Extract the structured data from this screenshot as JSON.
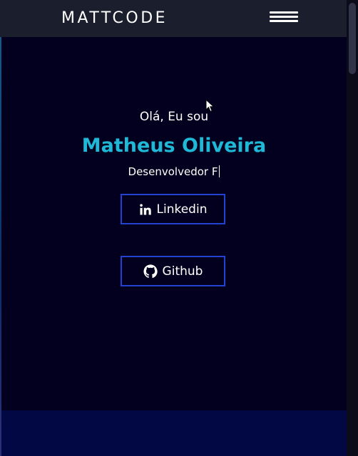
{
  "header": {
    "brand": "MATTCODE",
    "menu_icon": "hamburger-menu-icon"
  },
  "hero": {
    "greeting": "Olá, Eu sou",
    "name": "Matheus Oliveira",
    "role_typed": "Desenvolvedor F"
  },
  "buttons": [
    {
      "label": "Linkedin",
      "icon": "linkedin-icon"
    },
    {
      "label": "Github",
      "icon": "github-icon"
    }
  ],
  "colors": {
    "background": "#03001f",
    "header_bg": "#1b1e2c",
    "accent_name": "#1fb8d6",
    "button_border": "#2442d0",
    "footer_band": "#010843"
  }
}
